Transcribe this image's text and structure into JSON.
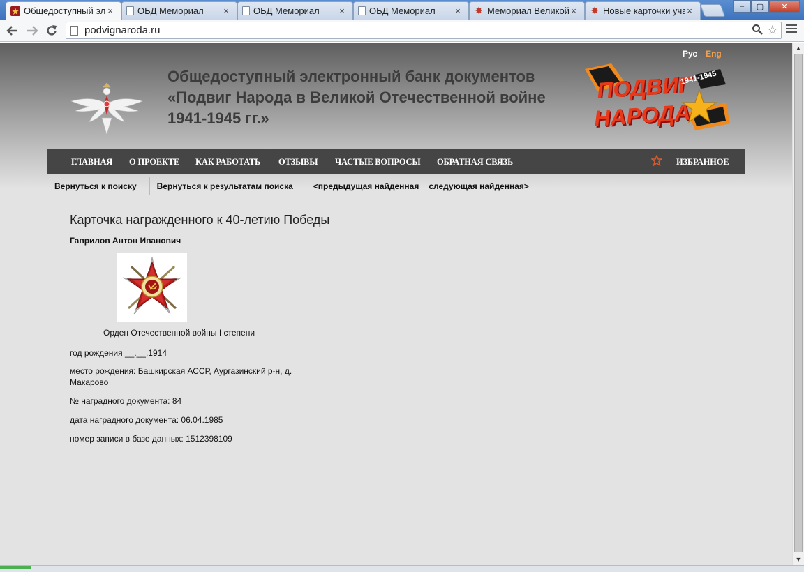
{
  "browser": {
    "tabs": [
      {
        "title": "Общедоступный эл",
        "favicon": "site-red-icon",
        "active": true
      },
      {
        "title": "ОБД Мемориал",
        "favicon": "page-icon",
        "active": false
      },
      {
        "title": "ОБД Мемориал",
        "favicon": "page-icon",
        "active": false
      },
      {
        "title": "ОБД Мемориал",
        "favicon": "page-icon",
        "active": false
      },
      {
        "title": "Мемориал Великой",
        "favicon": "red-star-icon",
        "active": false
      },
      {
        "title": "Новые карточки уча",
        "favicon": "red-star-icon",
        "active": false
      }
    ],
    "close_glyph": "×",
    "url": "podvignaroda.ru",
    "window_buttons": {
      "minimize": "–",
      "maximize": "▢",
      "close": "✕"
    }
  },
  "site": {
    "lang": {
      "ru": "Рус",
      "en": "Eng"
    },
    "title_lines": [
      "Общедоступный электронный банк документов",
      "«Подвиг Народа в Великой Отечественной войне",
      "1941-1945 гг.»"
    ],
    "logo": {
      "line1": "ПОДВИГ",
      "line2": "НАРОДА",
      "years": "1941-1945"
    },
    "nav": [
      {
        "label": "ГЛАВНАЯ"
      },
      {
        "label": "О ПРОЕКТЕ"
      },
      {
        "label": "КАК РАБОТАТЬ"
      },
      {
        "label": "ОТЗЫВЫ"
      },
      {
        "label": "ЧАСТЫЕ ВОПРОСЫ"
      },
      {
        "label": "ОБРАТНАЯ СВЯЗЬ"
      }
    ],
    "favorites_label": "ИЗБРАННОЕ",
    "subnav": {
      "back_to_search": "Вернуться к поиску",
      "back_to_results": "Вернуться к результатам поиска",
      "prev_found": "<предыдущая найденная",
      "next_found": "следующая найденная>"
    },
    "colors": {
      "nav_bg": "#454545",
      "accent": "#e05a2a",
      "page_bg": "#e3e3e3"
    }
  },
  "card": {
    "title": "Карточка награжденного к 40-летию Победы",
    "person": "Гаврилов Антон Иванович",
    "award_name": "Орден Отечественной войны I степени",
    "award_icon": "order-patriotic-war-icon",
    "fields": {
      "birth_year": "год рождения __.__.1914",
      "birth_place": "место рождения: Башкирская АССР, Аургазинский р-н, д. Макарово",
      "doc_number": "№ наградного документа: 84",
      "doc_date": "дата наградного документа: 06.04.1985",
      "record_id": "номер записи в базе данных: 1512398109"
    }
  }
}
